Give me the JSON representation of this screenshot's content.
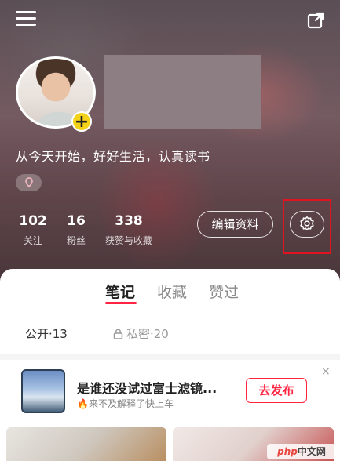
{
  "profile": {
    "bio": "从今天开始，好好生活，认真读书",
    "stats": [
      {
        "value": "102",
        "label": "关注"
      },
      {
        "value": "16",
        "label": "粉丝"
      },
      {
        "value": "338",
        "label": "获赞与收藏"
      }
    ],
    "edit_button": "编辑资料",
    "add_badge": "+"
  },
  "tabs": [
    {
      "label": "笔记",
      "active": true
    },
    {
      "label": "收藏",
      "active": false
    },
    {
      "label": "赞过",
      "active": false
    }
  ],
  "filters": {
    "public": "公开·13",
    "private": "私密·20"
  },
  "promo": {
    "title": "是谁还没试过富士滤镜...",
    "subtitle": "来不及解释了快上车",
    "button": "去发布",
    "close": "×"
  },
  "watermark": {
    "logo": "php",
    "text": "中文网"
  },
  "colors": {
    "accent": "#ff2442",
    "highlight": "#e0141e",
    "badge": "#f4d21a"
  },
  "icons": [
    "menu-icon",
    "share-icon",
    "tag-icon",
    "gear-icon",
    "lock-icon",
    "fire-icon",
    "close-icon"
  ]
}
